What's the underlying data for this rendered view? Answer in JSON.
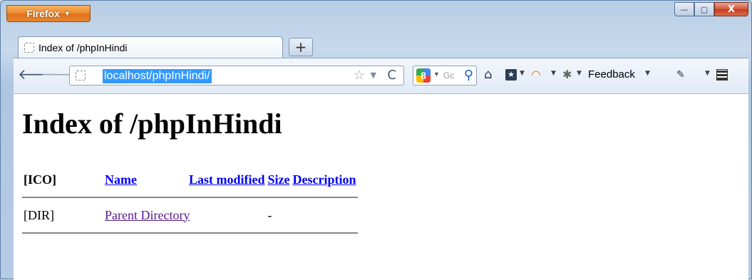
{
  "window": {
    "menu_button": "Firefox",
    "controls": {
      "minimize": "—",
      "maximize": "▢",
      "close": "X"
    }
  },
  "tabs": [
    {
      "label": "Index of /phpInHindi"
    }
  ],
  "new_tab_label": "+",
  "address_bar": {
    "url": "localhost/phpInHindi/"
  },
  "search": {
    "placeholder": "Gc"
  },
  "toolbar": {
    "feedback_label": "Feedback"
  },
  "page": {
    "title": "Index of /phpInHindi",
    "table": {
      "headers": {
        "icon": "[ICO]",
        "name": "Name",
        "last_modified": "Last modified",
        "size": "Size",
        "description": "Description"
      },
      "rows": [
        {
          "icon": "[DIR]",
          "name": "Parent Directory",
          "last_modified": "",
          "size": "-",
          "description": ""
        }
      ]
    }
  },
  "icons": [
    "back-arrow-icon",
    "forward-arrow-icon",
    "star-icon",
    "reload-icon",
    "search-icon",
    "home-icon",
    "bookmark-icon",
    "rainbow-icon",
    "bug-icon",
    "dropper-icon",
    "grid-icon"
  ]
}
